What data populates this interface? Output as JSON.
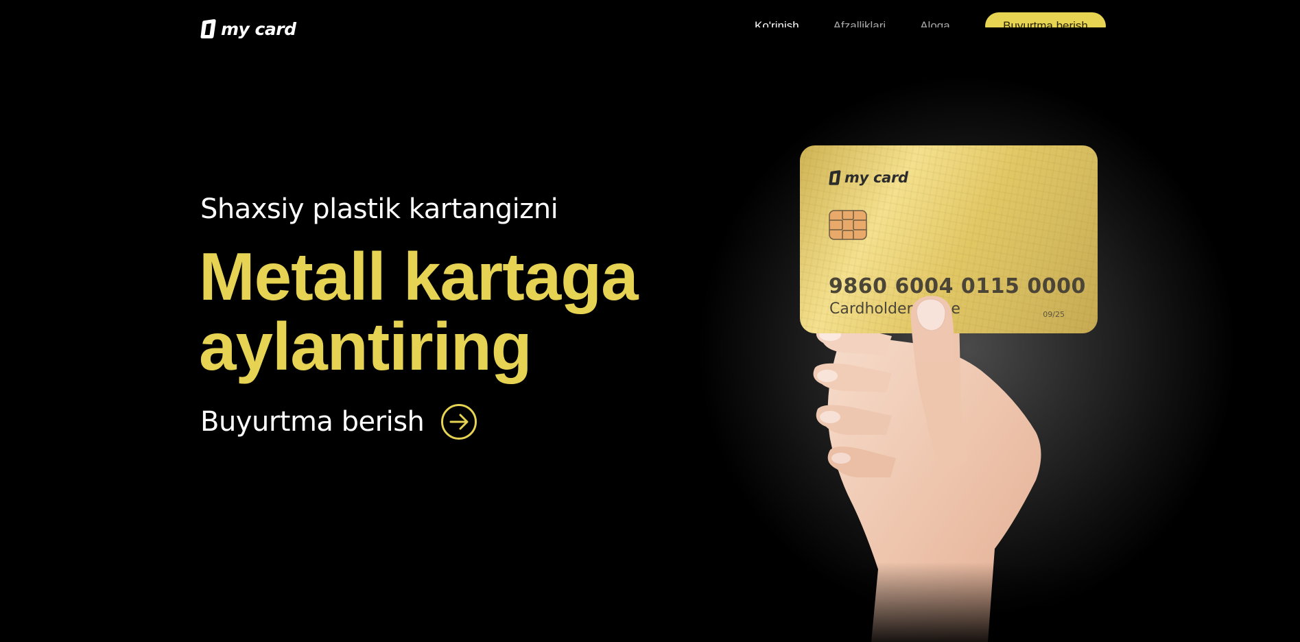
{
  "brand": {
    "name": "my card",
    "accent": "#e6d354",
    "background": "#000000"
  },
  "nav": {
    "links": [
      {
        "label": "Ko'rinish",
        "active": true
      },
      {
        "label": "Afzalliklari",
        "active": false
      },
      {
        "label": "Aloqa",
        "active": false
      }
    ],
    "cta_label": "Buyurtma berish"
  },
  "hero": {
    "subtitle": "Shaxsiy plastik kartangizni",
    "title_line1": "Metall kartaga",
    "title_line2": "aylantiring",
    "cta_label": "Buyurtma berish",
    "cta_icon": "arrow-right-circle-icon"
  },
  "card": {
    "brand": "my card",
    "number": "9860 6004 0115 0000",
    "holder": "Cardholder name",
    "expiry": "09/25",
    "color": "gold"
  }
}
